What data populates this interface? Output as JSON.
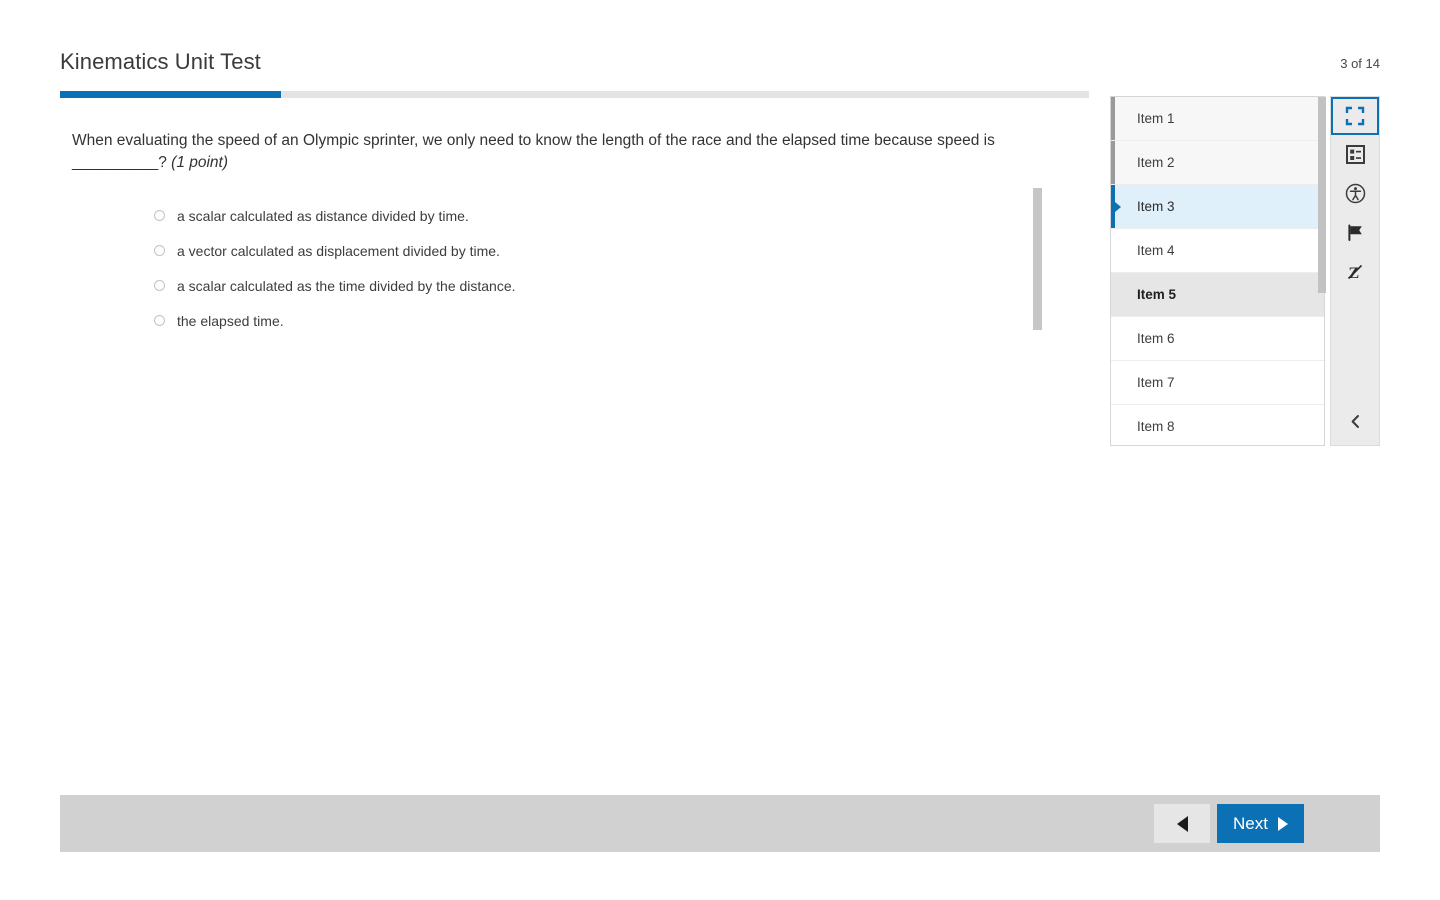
{
  "header": {
    "title": "Kinematics Unit Test",
    "counter": "3 of 14"
  },
  "progress": {
    "percent": 21.5
  },
  "question": {
    "text_part1": "When evaluating the speed of an Olympic sprinter, we only need to know the length of the race and the elapsed time because speed is ",
    "blank": "__________",
    "text_part2": "? ",
    "points": "(1 point)",
    "options": [
      {
        "label": "a scalar calculated as distance divided by time.",
        "selected": false
      },
      {
        "label": "a vector calculated as displacement divided by time.",
        "selected": false
      },
      {
        "label": "a scalar calculated as the time divided by the distance.",
        "selected": false
      },
      {
        "label": "the elapsed time.",
        "selected": false
      }
    ]
  },
  "item_panel": {
    "items": [
      {
        "label": "Item 1",
        "state": "visited"
      },
      {
        "label": "Item 2",
        "state": "visited"
      },
      {
        "label": "Item 3",
        "state": "current"
      },
      {
        "label": "Item 4",
        "state": "unvisited"
      },
      {
        "label": "Item 5",
        "state": "hovered"
      },
      {
        "label": "Item 6",
        "state": "unvisited"
      },
      {
        "label": "Item 7",
        "state": "unvisited"
      },
      {
        "label": "Item 8",
        "state": "unvisited"
      }
    ]
  },
  "tools": [
    {
      "icon": "fullscreen-icon",
      "active": true
    },
    {
      "icon": "item-review-list-icon",
      "active": false
    },
    {
      "icon": "accessibility-icon",
      "active": false
    },
    {
      "icon": "flag-icon",
      "active": false
    },
    {
      "icon": "strikethrough-icon",
      "active": false
    }
  ],
  "tool_collapse": {
    "icon": "chevron-left-icon"
  },
  "footer": {
    "previous_label": "",
    "next_label": "Next"
  },
  "colors": {
    "accent": "#0c70b4",
    "progress_track": "#e4e4e4",
    "current_item_bg": "#e0f0fa",
    "hover_item_bg": "#e6e6e6",
    "footer_bg": "#d1d1d1"
  }
}
